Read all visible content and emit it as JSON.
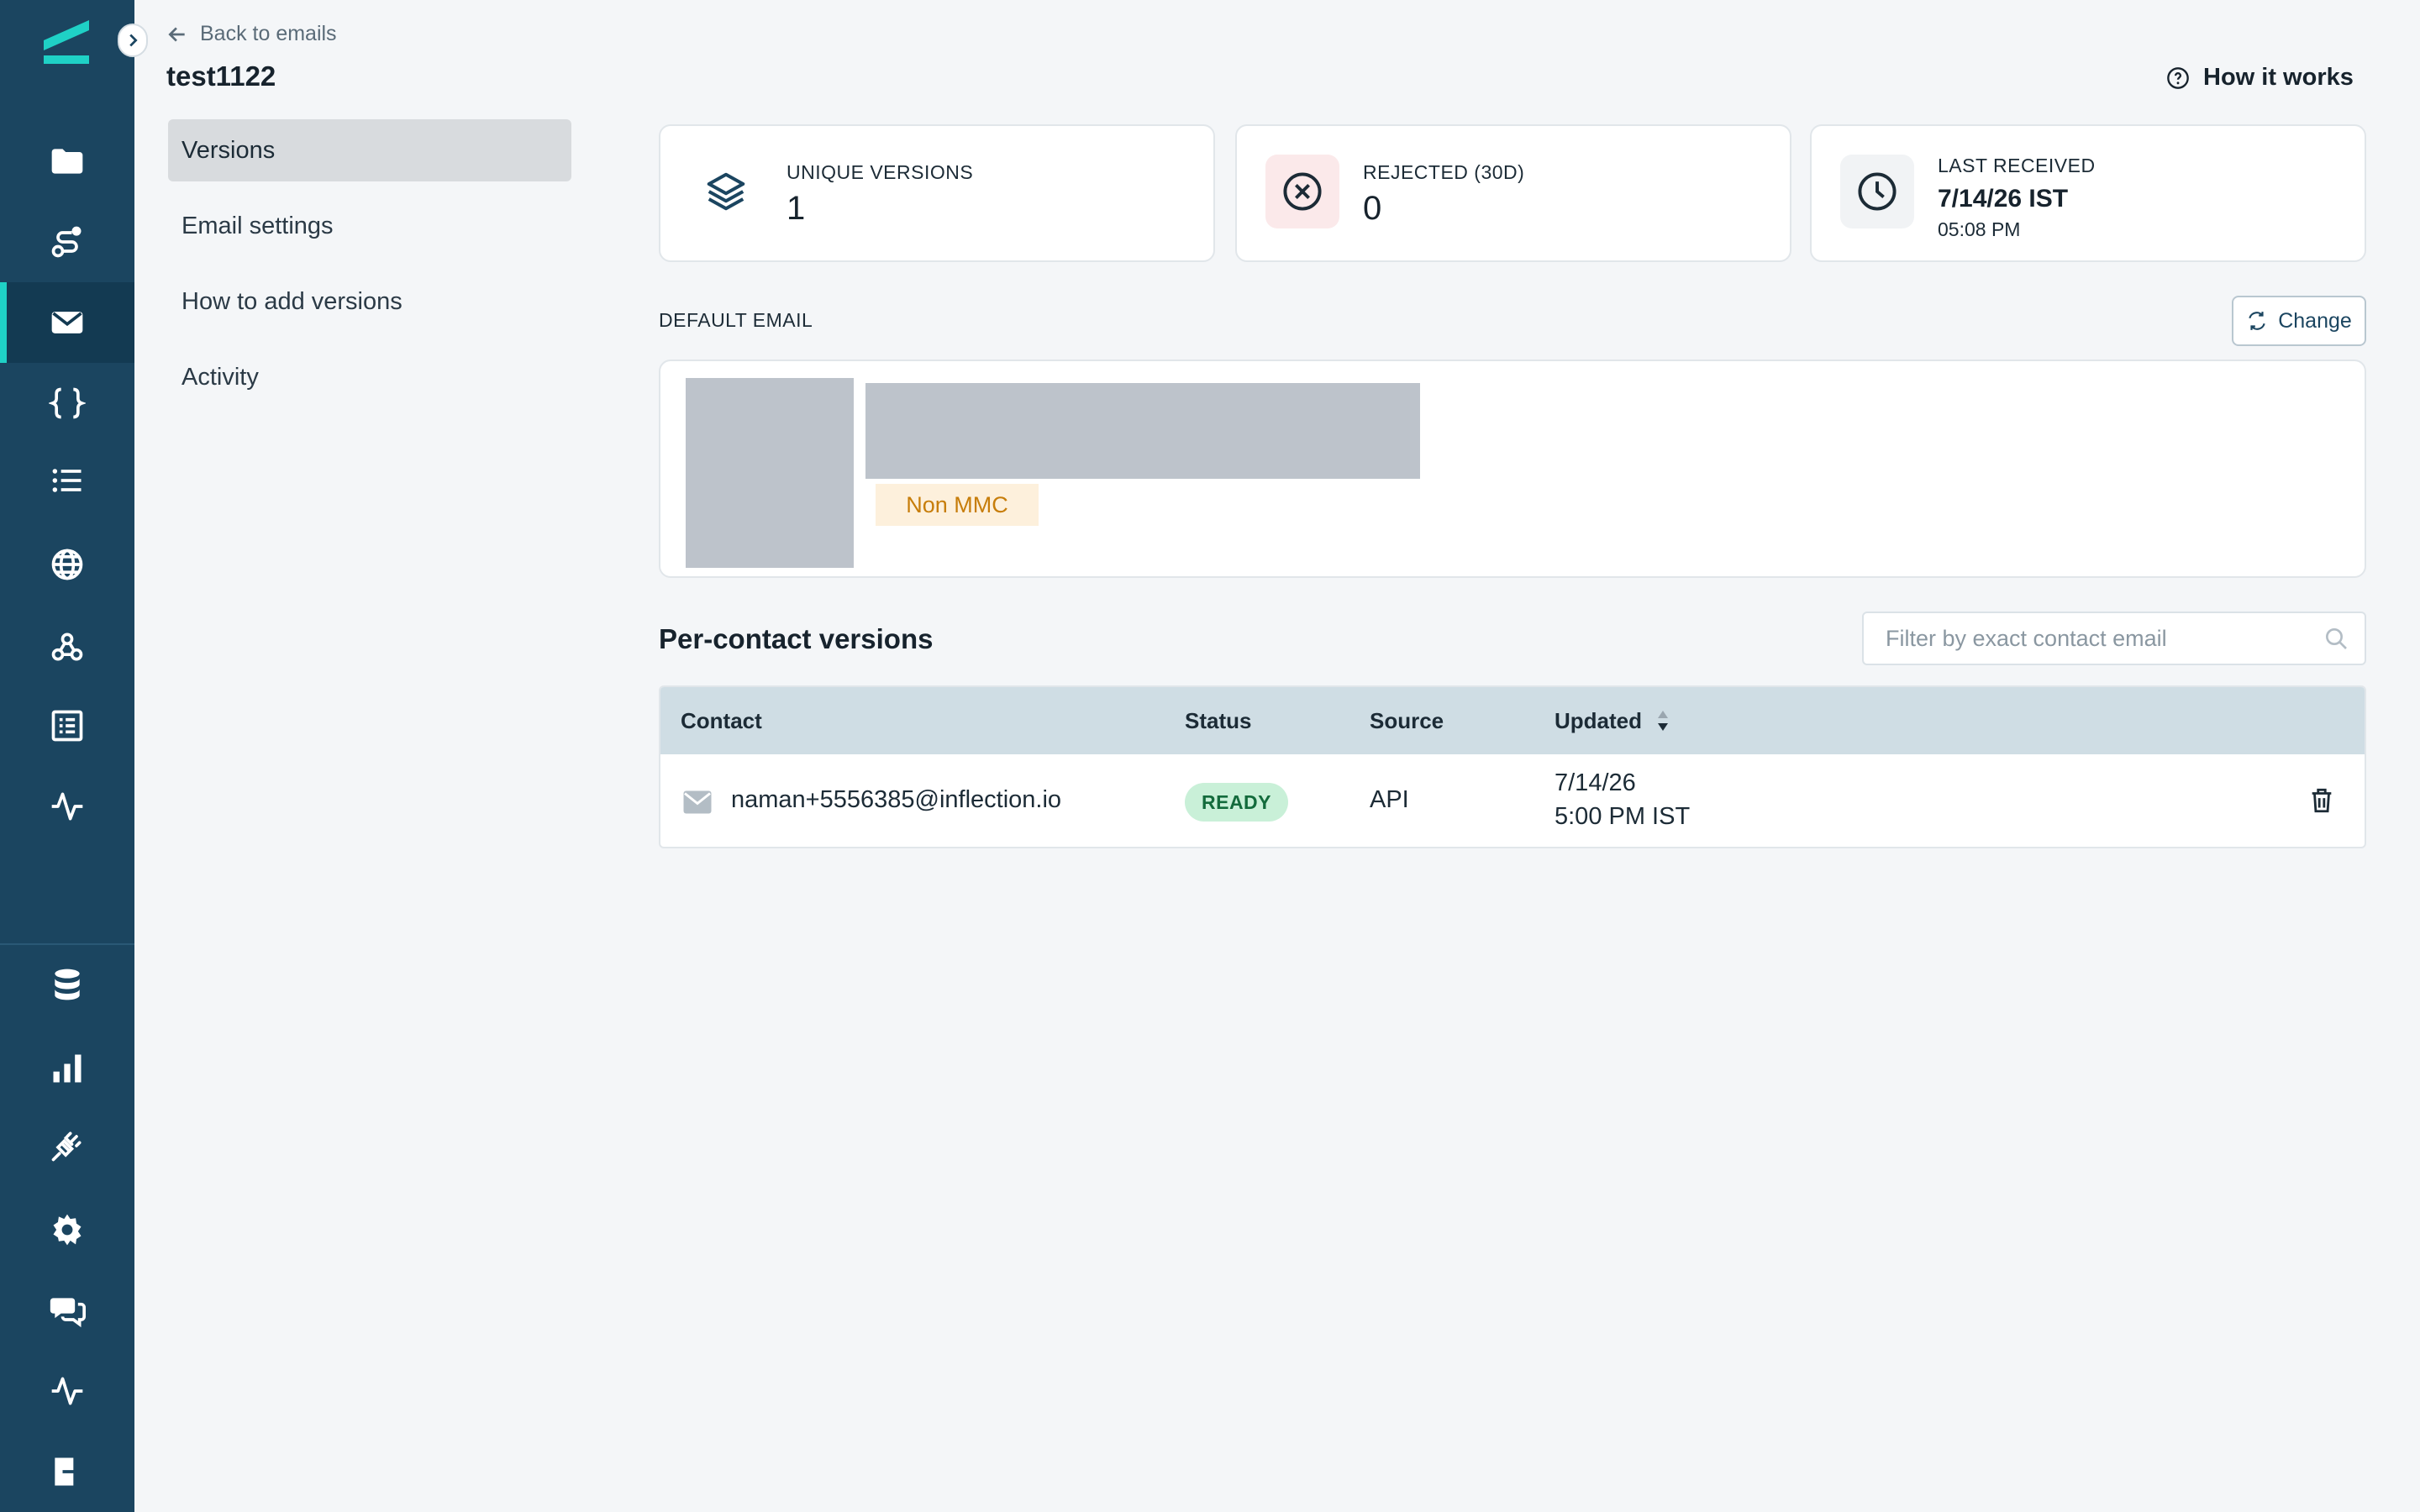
{
  "nav": {
    "back_label": "Back to emails",
    "title": "test1122",
    "how_it_works": "How it works"
  },
  "subnav": {
    "items": [
      {
        "label": "Versions",
        "active": true
      },
      {
        "label": "Email settings",
        "active": false
      },
      {
        "label": "How to add versions",
        "active": false
      },
      {
        "label": "Activity",
        "active": false
      }
    ]
  },
  "stats": {
    "unique_versions": {
      "label": "UNIQUE VERSIONS",
      "value": "1",
      "icon": "layers-icon"
    },
    "rejected": {
      "label": "REJECTED (30D)",
      "value": "0",
      "icon": "x-circle-icon"
    },
    "last_received": {
      "label": "LAST RECEIVED",
      "date": "7/14/26 IST",
      "time": "05:08 PM",
      "icon": "clock-icon"
    }
  },
  "default_email": {
    "label": "DEFAULT EMAIL",
    "change_label": "Change",
    "tag": "Non MMC"
  },
  "per_contact": {
    "title": "Per-contact versions",
    "filter_placeholder": "Filter by exact contact email",
    "columns": {
      "contact": "Contact",
      "status": "Status",
      "source": "Source",
      "updated": "Updated"
    },
    "rows": [
      {
        "contact": "naman+5556385@inflection.io",
        "status": "READY",
        "source": "API",
        "updated_date": "7/14/26",
        "updated_time": "5:00 PM IST"
      }
    ]
  },
  "colors": {
    "sidebar": "#1b4560",
    "accent": "#1fd1c6",
    "ready_badge": "#c9f0d8",
    "tag_bg": "#fdf0dc",
    "tag_text": "#c77d0a"
  }
}
